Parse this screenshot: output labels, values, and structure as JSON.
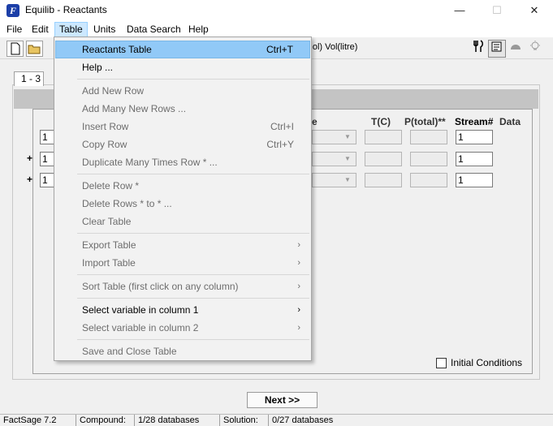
{
  "window": {
    "title": "Equilib - Reactants",
    "app_icon_letter": "F",
    "minimize": "—",
    "maximize": "☐",
    "close": "✕"
  },
  "menubar": [
    "File",
    "Edit",
    "Table",
    "Units",
    "Data Search",
    "Help"
  ],
  "toolbar": {
    "units_label": "(mol)  Vol(litre)"
  },
  "tab": {
    "label": "1 - 3"
  },
  "table": {
    "headers": {
      "t": "T(C)",
      "p": "P(total)**",
      "stream": "Stream#",
      "data": "Data",
      "partial_e": "e"
    },
    "rows": [
      {
        "plus": "",
        "qty": "1",
        "stream": "1"
      },
      {
        "plus": "+",
        "qty": "1",
        "stream": "1"
      },
      {
        "plus": "+",
        "qty": "1",
        "stream": "1"
      }
    ]
  },
  "initial_conditions": "Initial Conditions",
  "next_button": "Next >>",
  "status": {
    "version": "FactSage 7.2",
    "compound_label": "Compound:",
    "compound_value": "1/28 databases",
    "solution_label": "Solution:",
    "solution_value": "0/27 databases"
  },
  "dropdown": {
    "items": [
      {
        "label": "Reactants Table",
        "shortcut": "Ctrl+T",
        "enabled": true,
        "highlighted": true
      },
      {
        "label": "Help ...",
        "shortcut": "",
        "enabled": true
      },
      {
        "label": "Add New Row",
        "shortcut": "",
        "enabled": false
      },
      {
        "label": "Add Many New Rows ...",
        "shortcut": "",
        "enabled": false
      },
      {
        "label": "Insert Row",
        "shortcut": "Ctrl+I",
        "enabled": false
      },
      {
        "label": "Copy Row",
        "shortcut": "Ctrl+Y",
        "enabled": false
      },
      {
        "label": "Duplicate Many Times  Row * ...",
        "shortcut": "",
        "enabled": false
      },
      {
        "label": "Delete Row *",
        "shortcut": "",
        "enabled": false
      },
      {
        "label": "Delete Rows * to * ...",
        "shortcut": "",
        "enabled": false
      },
      {
        "label": "Clear Table",
        "shortcut": "",
        "enabled": false
      },
      {
        "label": "Export Table",
        "submenu": true,
        "enabled": false
      },
      {
        "label": "Import Table",
        "submenu": true,
        "enabled": false
      },
      {
        "label": "Sort Table (first click on any column)",
        "submenu": true,
        "enabled": false
      },
      {
        "label": "Select variable in column 1",
        "submenu": true,
        "enabled": true
      },
      {
        "label": "Select variable in column 2",
        "submenu": true,
        "enabled": false
      },
      {
        "label": "Save and Close Table",
        "shortcut": "",
        "enabled": false
      }
    ],
    "arrow": "›"
  }
}
